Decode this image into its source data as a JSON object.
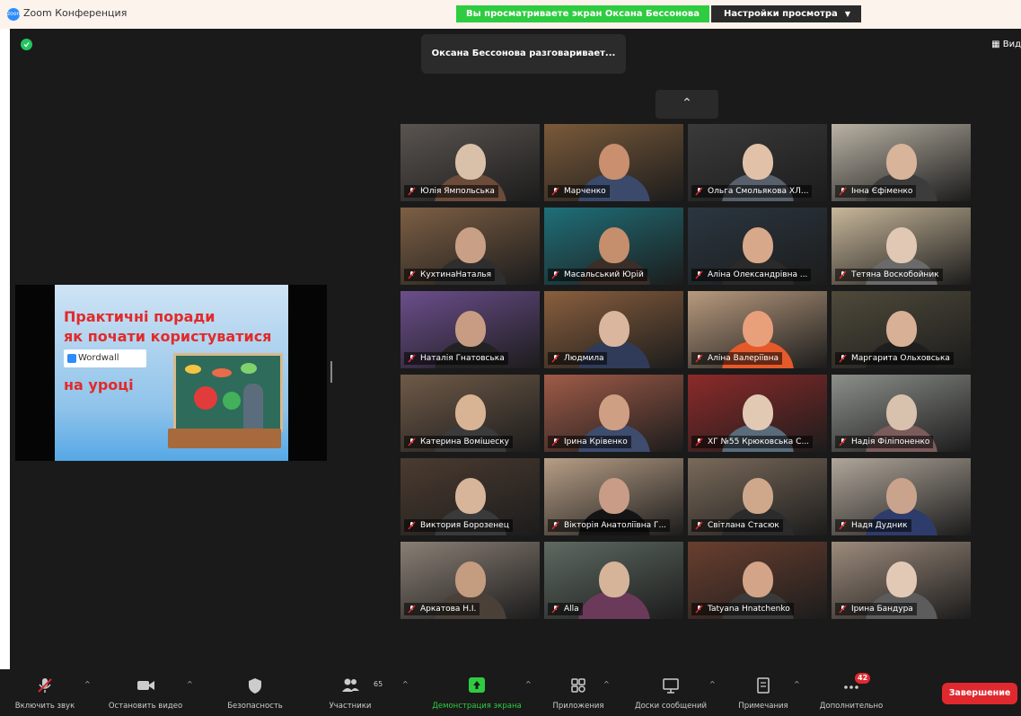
{
  "window": {
    "title": "Zoom Конференция",
    "logo_text": "zoom"
  },
  "share_banner": {
    "text": "Вы просматриваете экран Оксана Бессонова",
    "view_options_label": "Настройки просмотра"
  },
  "meeting": {
    "speaking_text": "Оксана Бессонова разговаривает...",
    "view_label": "Вид"
  },
  "shared_slide": {
    "line1": "Практичні поради",
    "line2": "як почати користуватися",
    "brand": "Wordwall",
    "line3": "на уроці"
  },
  "participants": [
    {
      "name": "Юлія Ямпольська"
    },
    {
      "name": "Марченко"
    },
    {
      "name": "Ольга Смольякова ХЛ..."
    },
    {
      "name": "Інна Єфіменко"
    },
    {
      "name": "КухтинаНаталья"
    },
    {
      "name": "Масальський Юрій"
    },
    {
      "name": "Аліна Олександрівна ..."
    },
    {
      "name": "Тетяна Воскобойник"
    },
    {
      "name": "Наталія Гнатовська"
    },
    {
      "name": "Людмила"
    },
    {
      "name": "Аліна Валеріївна"
    },
    {
      "name": "Маргарита Ольховська"
    },
    {
      "name": "Катерина Вомішеску"
    },
    {
      "name": "Ірина Крівенко"
    },
    {
      "name": "ХГ №55 Крюковська С..."
    },
    {
      "name": "Надія Філіпоненко"
    },
    {
      "name": "Виктория Борозенец"
    },
    {
      "name": "Вікторія Анатоліївна Г..."
    },
    {
      "name": "Світлана Стасюк"
    },
    {
      "name": "Надя Дудник"
    },
    {
      "name": "Аркатова Н.І."
    },
    {
      "name": "Alla"
    },
    {
      "name": "Tatyana Hnatchenko"
    },
    {
      "name": "Ірина Бандура"
    }
  ],
  "toolbar": {
    "mute_label": "Включить звук",
    "video_label": "Остановить видео",
    "security_label": "Безопасность",
    "participants_label": "Участники",
    "participants_count": "65",
    "share_label": "Демонстрация экрана",
    "apps_label": "Приложения",
    "whiteboards_label": "Доски сообщений",
    "notes_label": "Примечания",
    "more_label": "Дополнительно",
    "more_badge": "42",
    "end_label": "Завершение"
  },
  "colors": {
    "accent_green": "#2ecc40",
    "end_red": "#e0292e",
    "stage_bg": "#1a1a1a"
  }
}
